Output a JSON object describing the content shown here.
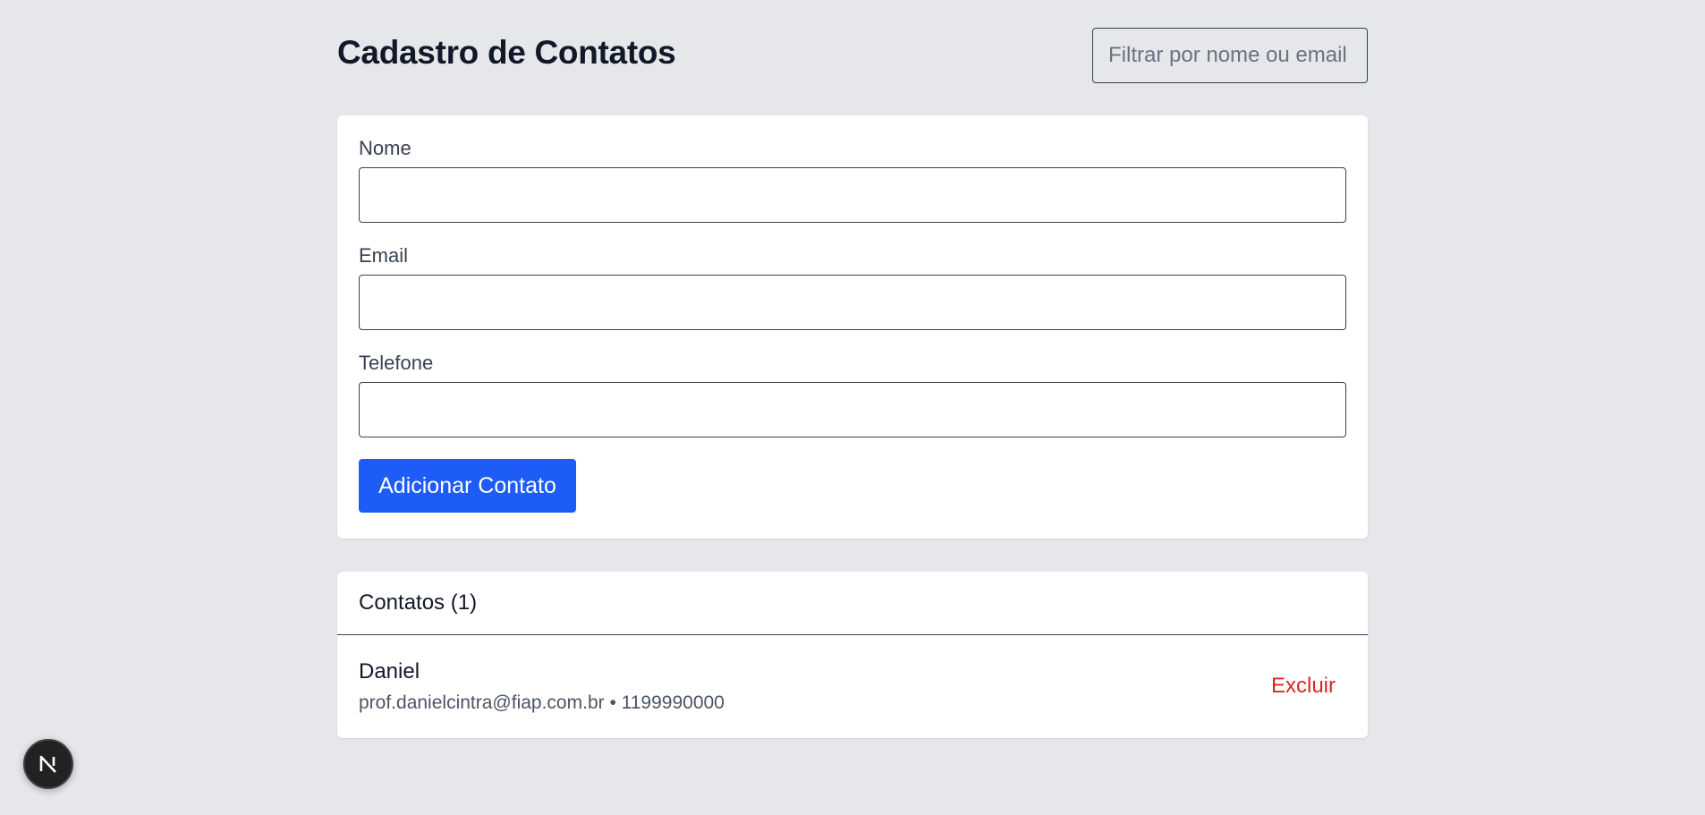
{
  "header": {
    "title": "Cadastro de Contatos",
    "filter_placeholder": "Filtrar por nome ou email"
  },
  "form": {
    "name_label": "Nome",
    "name_value": "",
    "email_label": "Email",
    "email_value": "",
    "phone_label": "Telefone",
    "phone_value": "",
    "submit_label": "Adicionar Contato"
  },
  "contacts": {
    "title": "Contatos (1)",
    "items": [
      {
        "name": "Daniel",
        "details": "prof.danielcintra@fiap.com.br • 1199990000",
        "delete_label": "Excluir"
      }
    ]
  },
  "badge": {
    "icon": "nextjs-icon"
  },
  "colors": {
    "background": "#e5e7eb",
    "primary": "#1d5cf6",
    "danger": "#dc2626",
    "card": "#ffffff"
  }
}
